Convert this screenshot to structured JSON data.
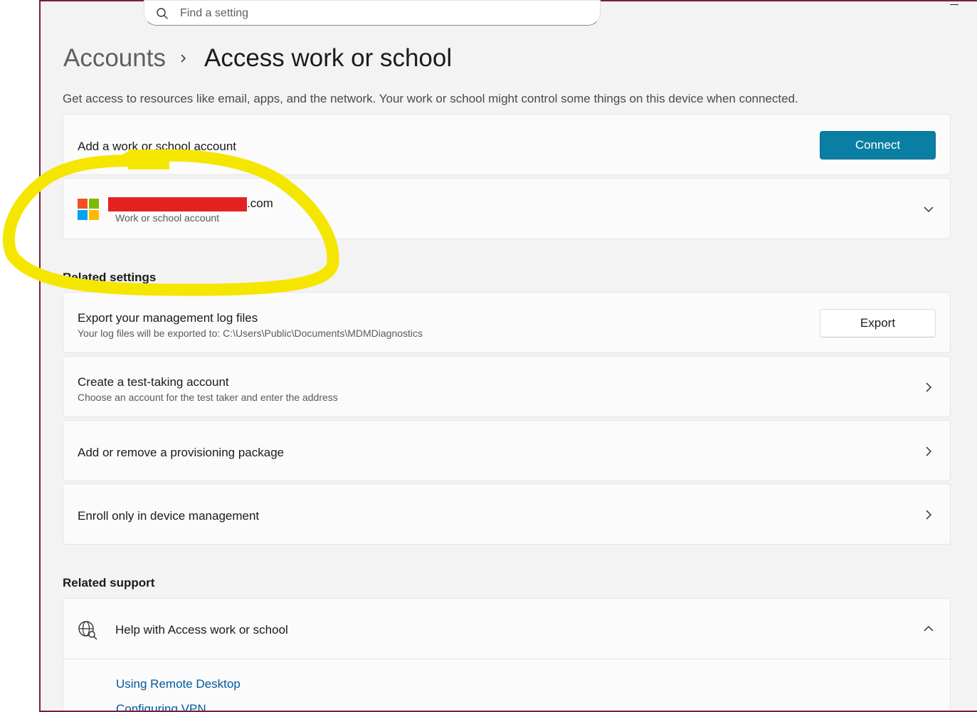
{
  "search": {
    "placeholder": "Find a setting"
  },
  "breadcrumb": {
    "parent": "Accounts",
    "current": "Access work or school"
  },
  "description": "Get access to resources like email, apps, and the network. Your work or school might control some things on this device when connected.",
  "add_account": {
    "label": "Add a work or school account",
    "button": "Connect"
  },
  "account": {
    "email_suffix": ".com",
    "type": "Work or school account"
  },
  "related_settings": {
    "title": "Related settings",
    "export": {
      "title": "Export your management log files",
      "subtitle": "Your log files will be exported to: C:\\Users\\Public\\Documents\\MDMDiagnostics",
      "button": "Export"
    },
    "test_account": {
      "title": "Create a test-taking account",
      "subtitle": "Choose an account for the test taker and enter the address"
    },
    "provisioning": {
      "title": "Add or remove a provisioning package"
    },
    "enroll": {
      "title": "Enroll only in device management"
    }
  },
  "related_support": {
    "title": "Related support",
    "help_title": "Help with Access work or school",
    "links": [
      "Using Remote Desktop",
      "Configuring VPN"
    ]
  },
  "colors": {
    "accent": "#0b7ea3",
    "window_border": "#7a1f3d",
    "highlight": "#f5e600",
    "redaction": "#e52222",
    "link": "#005a9e"
  },
  "icons": [
    "search-icon",
    "chevron-right-icon",
    "chevron-down-icon",
    "chevron-up-icon",
    "microsoft-logo-icon",
    "globe-search-icon",
    "minimize-icon"
  ]
}
